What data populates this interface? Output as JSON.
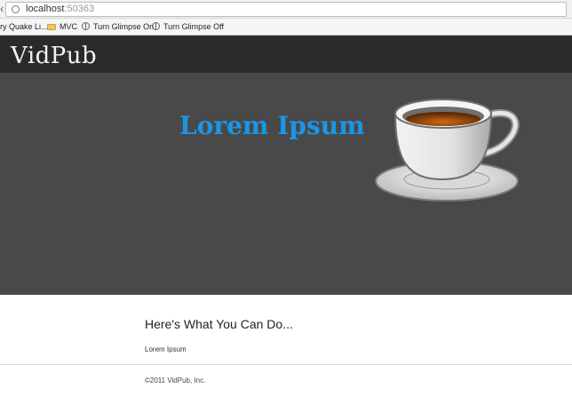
{
  "browser": {
    "url_host": "localhost",
    "url_port": ":50363",
    "back_glyph": "‹",
    "bookmarks": [
      {
        "label": "ry Quake Li...",
        "icon": "none"
      },
      {
        "label": "MVC",
        "icon": "folder-icon"
      },
      {
        "label": "Turn Glimpse On",
        "icon": "globe-icon"
      },
      {
        "label": "Turn Glimpse Off",
        "icon": "globe-icon"
      }
    ]
  },
  "site": {
    "logo": "VidPub",
    "hero_title": "Lorem Ipsum",
    "hero_image": "coffee-cup-icon",
    "section_title": "Here's What You Can Do...",
    "section_text": "Lorem Ipsum",
    "footer": "©2011 VidPub, Inc."
  },
  "colors": {
    "header_bg": "#2a2a2a",
    "hero_bg": "#494949",
    "hero_title": "#1a96e6"
  }
}
